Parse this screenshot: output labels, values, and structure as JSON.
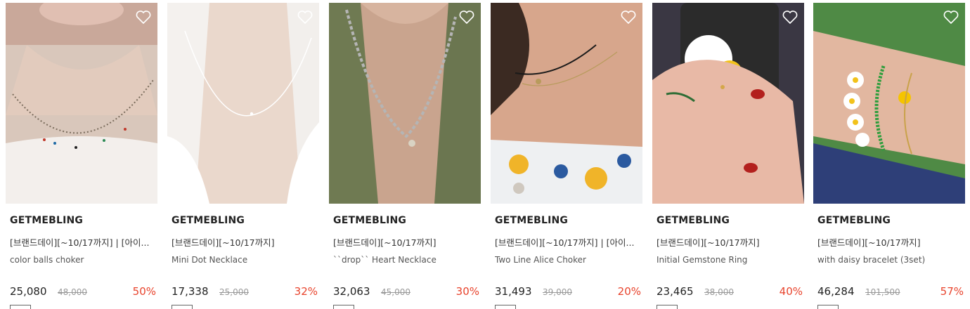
{
  "products": [
    {
      "brand": "GETMEBLING",
      "event": "[브랜드데이][~10/17까지] | [아이...",
      "name": "color balls choker",
      "price": "25,080",
      "original_price": "48,000",
      "discount": "50%",
      "image": "necklace-beads-photo",
      "icon": "heart-outline-icon"
    },
    {
      "brand": "GETMEBLING",
      "event": "[브랜드데이][~10/17까지]",
      "name": "Mini Dot Necklace",
      "price": "17,338",
      "original_price": "25,000",
      "discount": "32%",
      "image": "silver-necklace-photo",
      "icon": "heart-outline-icon"
    },
    {
      "brand": "GETMEBLING",
      "event": "[브랜드데이][~10/17까지]",
      "name": "``drop`` Heart Necklace",
      "price": "32,063",
      "original_price": "45,000",
      "discount": "30%",
      "image": "chain-necklace-photo",
      "icon": "heart-outline-icon"
    },
    {
      "brand": "GETMEBLING",
      "event": "[브랜드데이][~10/17까지] | [아이...",
      "name": "Two Line Alice Choker",
      "price": "31,493",
      "original_price": "39,000",
      "discount": "20%",
      "image": "choker-photo",
      "icon": "heart-outline-icon"
    },
    {
      "brand": "GETMEBLING",
      "event": "[브랜드데이][~10/17까지]",
      "name": "Initial Gemstone Ring",
      "price": "23,465",
      "original_price": "38,000",
      "discount": "40%",
      "image": "ring-hand-photo",
      "icon": "heart-outline-icon"
    },
    {
      "brand": "GETMEBLING",
      "event": "[브랜드데이][~10/17까지]",
      "name": "with daisy bracelet (3set)",
      "price": "46,284",
      "original_price": "101,500",
      "discount": "57%",
      "image": "daisy-bracelet-photo",
      "icon": "heart-outline-icon"
    }
  ],
  "colors": {
    "discount": "#e8432c",
    "brand_text": "#222222",
    "muted": "#999999"
  }
}
